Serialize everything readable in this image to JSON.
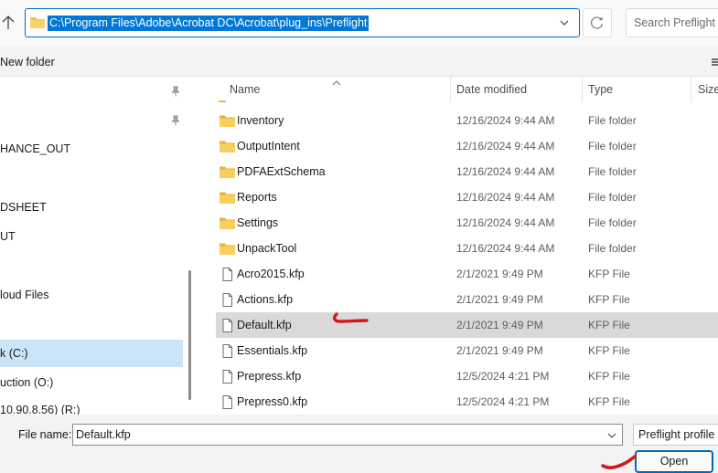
{
  "address_bar": {
    "path": "C:\\Program Files\\Adobe\\Acrobat DC\\Acrobat\\plug_ins\\Preflight",
    "folder_icon": "folder-icon",
    "chevron_icon": "chevron-down-icon"
  },
  "search": {
    "placeholder": "Search Preflight"
  },
  "toolbar": {
    "new_folder_label": "New folder"
  },
  "nav": {
    "items": [
      {
        "label": "HANCE_OUT",
        "selected": false
      },
      {
        "label": "DSHEET",
        "selected": false
      },
      {
        "label": "UT",
        "selected": false
      },
      {
        "label": "loud Files",
        "selected": false
      },
      {
        "label": "k (C:)",
        "selected": true
      },
      {
        "label": "uction (O:)",
        "selected": false
      },
      {
        "label": "10.90.8.56) (R:)",
        "selected": false
      }
    ]
  },
  "file_list": {
    "columns": [
      "Name",
      "Date modified",
      "Type",
      "Size"
    ],
    "rows": [
      {
        "name": "Inventory",
        "date": "12/16/2024 9:44 AM",
        "type": "File folder",
        "icon": "folder-icon",
        "selected": false
      },
      {
        "name": "OutputIntent",
        "date": "12/16/2024 9:44 AM",
        "type": "File folder",
        "icon": "folder-icon",
        "selected": false
      },
      {
        "name": "PDFAExtSchema",
        "date": "12/16/2024 9:44 AM",
        "type": "File folder",
        "icon": "folder-icon",
        "selected": false
      },
      {
        "name": "Reports",
        "date": "12/16/2024 9:44 AM",
        "type": "File folder",
        "icon": "folder-icon",
        "selected": false
      },
      {
        "name": "Settings",
        "date": "12/16/2024 9:44 AM",
        "type": "File folder",
        "icon": "folder-icon",
        "selected": false
      },
      {
        "name": "UnpackTool",
        "date": "12/16/2024 9:44 AM",
        "type": "File folder",
        "icon": "folder-icon",
        "selected": false
      },
      {
        "name": "Acro2015.kfp",
        "date": "2/1/2021 9:49 PM",
        "type": "KFP File",
        "icon": "file-icon",
        "selected": false
      },
      {
        "name": "Actions.kfp",
        "date": "2/1/2021 9:49 PM",
        "type": "KFP File",
        "icon": "file-icon",
        "selected": false
      },
      {
        "name": "Default.kfp",
        "date": "2/1/2021 9:49 PM",
        "type": "KFP File",
        "icon": "file-icon",
        "selected": true
      },
      {
        "name": "Essentials.kfp",
        "date": "2/1/2021 9:49 PM",
        "type": "KFP File",
        "icon": "file-icon",
        "selected": false
      },
      {
        "name": "Prepress.kfp",
        "date": "12/5/2024 4:21 PM",
        "type": "KFP File",
        "icon": "file-icon",
        "selected": false
      },
      {
        "name": "Prepress0.kfp",
        "date": "12/5/2024 4:21 PM",
        "type": "KFP File",
        "icon": "file-icon",
        "selected": false
      }
    ]
  },
  "footer": {
    "file_name_label": "File name:",
    "file_name_value": "Default.kfp",
    "file_type_value": "Preflight profile (",
    "open_label": "Open"
  },
  "colors": {
    "accent": "#0067c0",
    "selection_highlight": "#0078d7",
    "folder_yellow": "#f5c445",
    "annotation_red": "#d0181e"
  }
}
